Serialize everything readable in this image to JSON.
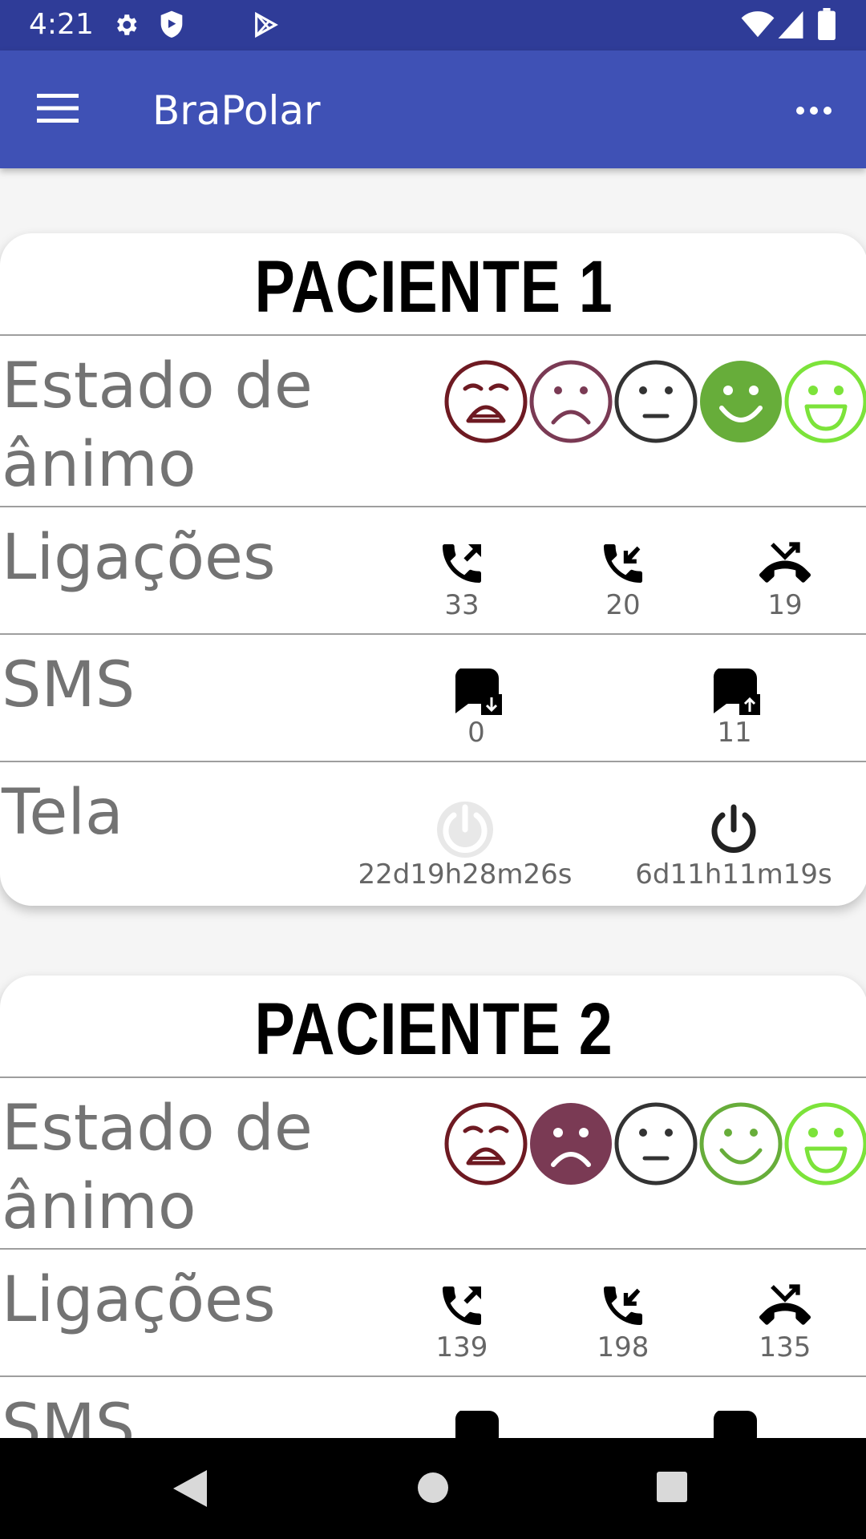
{
  "status_bar": {
    "time": "4:21"
  },
  "app_bar": {
    "title": "BraPolar"
  },
  "labels": {
    "mood": "Estado de ânimo",
    "calls": "Ligações",
    "sms": "SMS",
    "screen": "Tela"
  },
  "patients": [
    {
      "name": "PACIENTE 1",
      "mood_selected": "happy",
      "calls": {
        "outgoing": "33",
        "incoming": "20",
        "missed": "19"
      },
      "sms": {
        "received": "0",
        "sent": "11"
      },
      "screen": {
        "off_time": "22d19h28m26s",
        "on_time": "6d11h11m19s"
      }
    },
    {
      "name": "PACIENTE 2",
      "mood_selected": "sad",
      "calls": {
        "outgoing": "139",
        "incoming": "198",
        "missed": "135"
      }
    }
  ],
  "colors": {
    "status_bar": "#2f3c98",
    "app_bar": "#3f51b5",
    "very_sad": "#6e1a22",
    "sad": "#7a3a54",
    "neutral": "#333333",
    "happy": "#67ad3a",
    "very_happy": "#7ce33a"
  }
}
